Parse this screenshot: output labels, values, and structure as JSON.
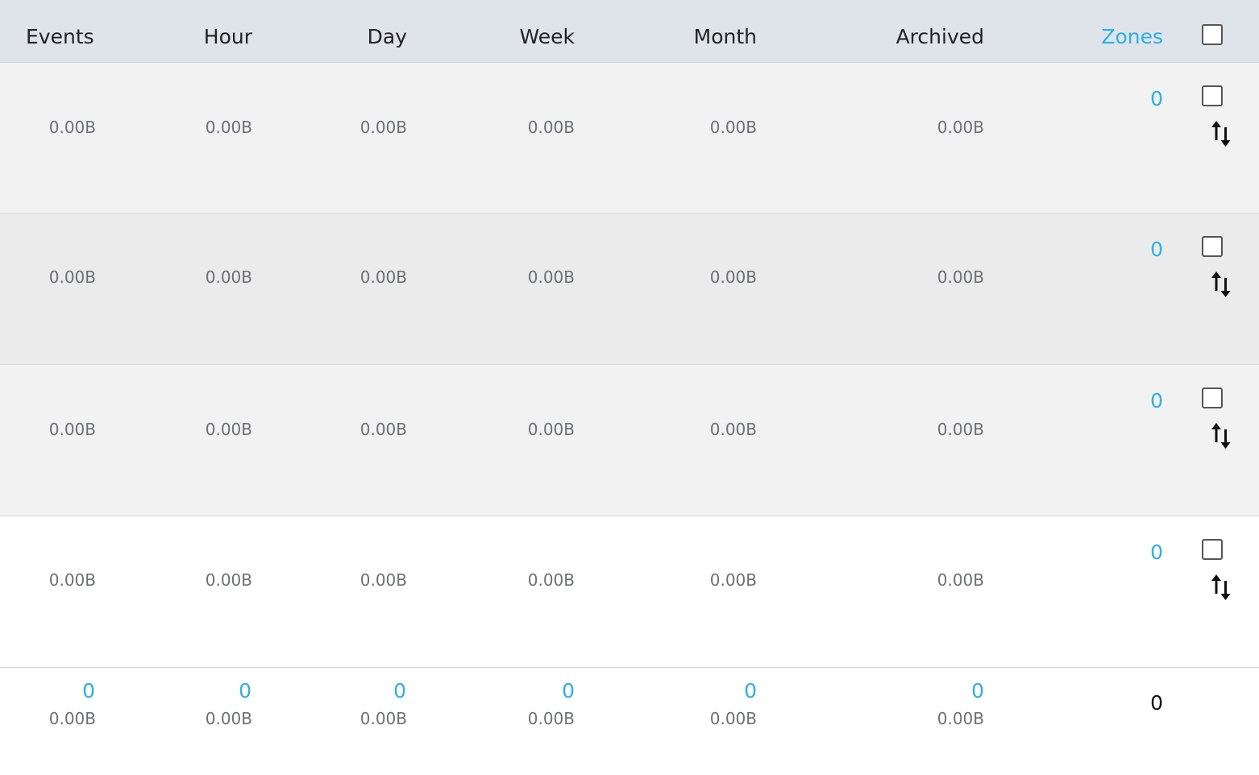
{
  "header": {
    "columns": [
      "Events",
      "Hour",
      "Day",
      "Week",
      "Month",
      "Archived",
      "Zones"
    ]
  },
  "rows": [
    {
      "events": "0.00B",
      "hour": "0.00B",
      "day": "0.00B",
      "week": "0.00B",
      "month": "0.00B",
      "archived": "0.00B",
      "zones": "0",
      "bg": "#f2f2f2"
    },
    {
      "events": "0.00B",
      "hour": "0.00B",
      "day": "0.00B",
      "week": "0.00B",
      "month": "0.00B",
      "archived": "0.00B",
      "zones": "0",
      "bg": "#ebebeb"
    },
    {
      "events": "0.00B",
      "hour": "0.00B",
      "day": "0.00B",
      "week": "0.00B",
      "month": "0.00B",
      "archived": "0.00B",
      "zones": "0",
      "bg": "#f2f2f2"
    },
    {
      "events": "0.00B",
      "hour": "0.00B",
      "day": "0.00B",
      "week": "0.00B",
      "month": "0.00B",
      "archived": "0.00B",
      "zones": "0",
      "bg": "#ffffff"
    }
  ],
  "totals": {
    "events": {
      "count": "0",
      "size": "0.00B"
    },
    "hour": {
      "count": "0",
      "size": "0.00B"
    },
    "day": {
      "count": "0",
      "size": "0.00B"
    },
    "week": {
      "count": "0",
      "size": "0.00B"
    },
    "month": {
      "count": "0",
      "size": "0.00B"
    },
    "archived": {
      "count": "0",
      "size": "0.00B"
    },
    "zones": "0"
  },
  "colors": {
    "header_bg": "#dfe4ea",
    "link": "#2bb0e8",
    "muted_text": "#6b7075"
  },
  "icons": {
    "row_action": "sort-arrows-icon"
  }
}
